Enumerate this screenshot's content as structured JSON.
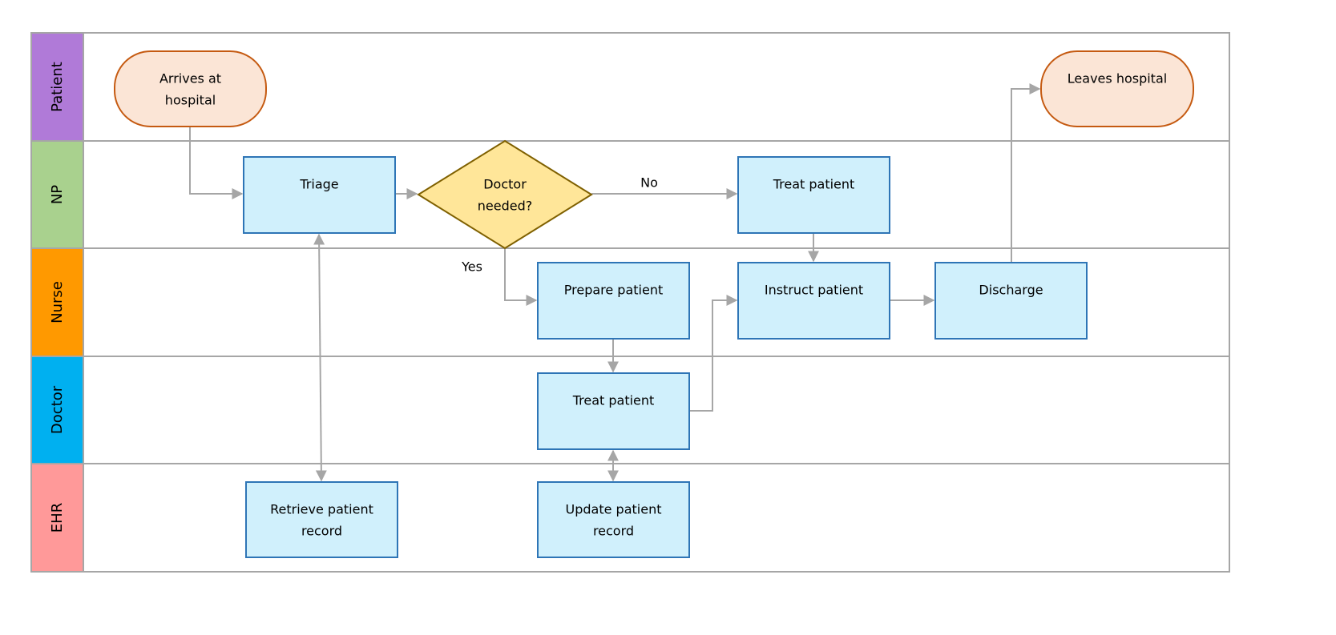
{
  "diagram": {
    "type": "swimlane-flowchart",
    "lanes": [
      {
        "id": "patient",
        "label": "Patient",
        "color": "#b07ad8"
      },
      {
        "id": "np",
        "label": "NP",
        "color": "#a9d18e"
      },
      {
        "id": "nurse",
        "label": "Nurse",
        "color": "#ff9900"
      },
      {
        "id": "doctor",
        "label": "Doctor",
        "color": "#00b0f0"
      },
      {
        "id": "ehr",
        "label": "EHR",
        "color": "#ff9999"
      }
    ],
    "nodes": [
      {
        "id": "arrives",
        "lane": "patient",
        "shape": "terminator",
        "lines": [
          "Arrives at",
          "hospital"
        ]
      },
      {
        "id": "leaves",
        "lane": "patient",
        "shape": "terminator",
        "lines": [
          "Leaves hospital"
        ]
      },
      {
        "id": "triage",
        "lane": "np",
        "shape": "process",
        "lines": [
          "Triage"
        ]
      },
      {
        "id": "decision",
        "lane": "np",
        "shape": "decision",
        "lines": [
          "Doctor",
          "needed?"
        ]
      },
      {
        "id": "np_treat",
        "lane": "np",
        "shape": "process",
        "lines": [
          "Treat patient"
        ]
      },
      {
        "id": "prepare",
        "lane": "nurse",
        "shape": "process",
        "lines": [
          "Prepare patient"
        ]
      },
      {
        "id": "instruct",
        "lane": "nurse",
        "shape": "process",
        "lines": [
          "Instruct patient"
        ]
      },
      {
        "id": "discharge",
        "lane": "nurse",
        "shape": "process",
        "lines": [
          "Discharge"
        ]
      },
      {
        "id": "doc_treat",
        "lane": "doctor",
        "shape": "process",
        "lines": [
          "Treat patient"
        ]
      },
      {
        "id": "retrieve",
        "lane": "ehr",
        "shape": "process",
        "lines": [
          "Retrieve patient",
          "record"
        ]
      },
      {
        "id": "update",
        "lane": "ehr",
        "shape": "process",
        "lines": [
          "Update patient",
          "record"
        ]
      }
    ],
    "edges": [
      {
        "from": "arrives",
        "to": "triage",
        "label": ""
      },
      {
        "from": "triage",
        "to": "decision",
        "label": ""
      },
      {
        "from": "decision",
        "to": "np_treat",
        "label": "No"
      },
      {
        "from": "decision",
        "to": "prepare",
        "label": "Yes"
      },
      {
        "from": "np_treat",
        "to": "instruct",
        "label": ""
      },
      {
        "from": "prepare",
        "to": "doc_treat",
        "label": ""
      },
      {
        "from": "doc_treat",
        "to": "instruct",
        "label": ""
      },
      {
        "from": "instruct",
        "to": "discharge",
        "label": ""
      },
      {
        "from": "discharge",
        "to": "leaves",
        "label": ""
      },
      {
        "from": "triage",
        "to": "retrieve",
        "label": "",
        "bidirectional": true
      },
      {
        "from": "doc_treat",
        "to": "update",
        "label": "",
        "bidirectional": true
      }
    ],
    "colors": {
      "process_fill": "#d0f0fc",
      "process_stroke": "#2e75b6",
      "terminator_fill": "#fbe5d6",
      "terminator_stroke": "#c55a11",
      "decision_fill": "#ffe699",
      "decision_stroke": "#7f6000",
      "connector": "#a6a6a6",
      "grid": "#a6a6a6"
    }
  }
}
